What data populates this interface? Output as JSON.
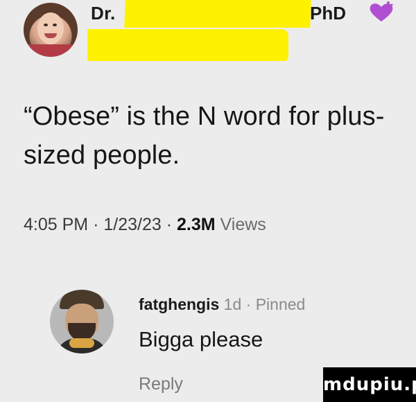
{
  "tweet": {
    "author_prefix": "Dr.",
    "author_suffix": "PhD",
    "text": "“Obese” is the N word for plus-sized people.",
    "time": "4:05 PM",
    "date": "1/23/23",
    "views_count": "2.3M",
    "views_label": "Views",
    "separator": "·"
  },
  "reply": {
    "username": "fatghengis",
    "age": "1d",
    "pinned_label": "Pinned",
    "separator": "·",
    "text": "Bigga please",
    "reply_label": "Reply"
  },
  "watermark": {
    "text": "mdupiu.pl"
  },
  "icons": {
    "verified_heart": "heart-icon"
  },
  "colors": {
    "redaction": "#fff200",
    "heart": "#b04fd1",
    "background": "#ececec"
  }
}
